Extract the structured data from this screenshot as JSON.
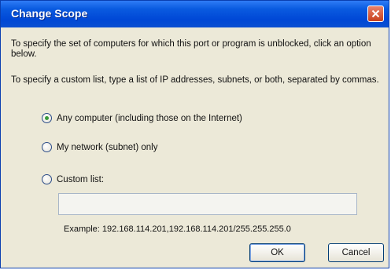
{
  "window": {
    "title": "Change Scope",
    "close_icon": "close-icon"
  },
  "instructions": {
    "line1": "To specify the set of computers for which this port or program is unblocked, click an option below.",
    "line2": "To specify a custom list, type a list of IP addresses, subnets, or both, separated by commas."
  },
  "options": [
    {
      "label": "Any computer (including those on the Internet)",
      "checked": true
    },
    {
      "label": "My network (subnet) only",
      "checked": false
    },
    {
      "label": "Custom list:",
      "checked": false
    }
  ],
  "custom_list": {
    "value": "",
    "example": "Example: 192.168.114.201,192.168.114.201/255.255.255.0"
  },
  "buttons": {
    "ok": "OK",
    "cancel": "Cancel"
  },
  "colors": {
    "titlebar": "#0a5be0",
    "dialog_bg": "#ece9d8",
    "close_button": "#c8401c"
  }
}
